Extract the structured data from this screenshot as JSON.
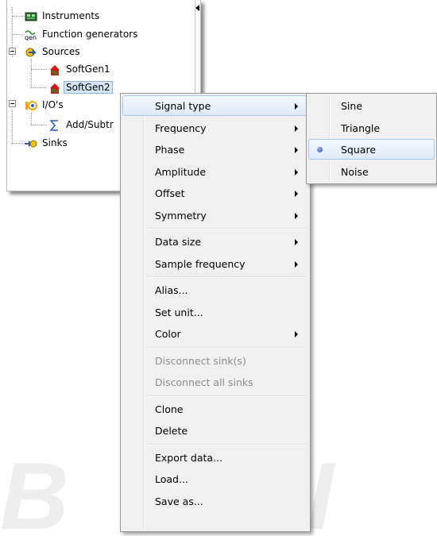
{
  "tree": {
    "items": [
      {
        "label": "Instruments",
        "icon": "instruments-icon"
      },
      {
        "label": "Function generators",
        "icon": "gen-icon"
      },
      {
        "label": "Sources",
        "icon": "sources-icon"
      },
      {
        "label": "SoftGen1",
        "icon": "softgen-icon"
      },
      {
        "label": "SoftGen2",
        "icon": "softgen-icon"
      },
      {
        "label": "I/O's",
        "icon": "io-icon"
      },
      {
        "label": "Add/Subtr",
        "icon": "sum-icon"
      },
      {
        "label": "Sinks",
        "icon": "sinks-icon"
      }
    ],
    "gen_glyph": "gen"
  },
  "context_menu": {
    "groups": [
      [
        {
          "label": "Signal type",
          "submenu": true,
          "highlighted": true
        },
        {
          "label": "Frequency",
          "submenu": true
        },
        {
          "label": "Phase",
          "submenu": true
        },
        {
          "label": "Amplitude",
          "submenu": true
        },
        {
          "label": "Offset",
          "submenu": true
        },
        {
          "label": "Symmetry",
          "submenu": true
        }
      ],
      [
        {
          "label": "Data size",
          "submenu": true
        },
        {
          "label": "Sample frequency",
          "submenu": true
        }
      ],
      [
        {
          "label": "Alias..."
        },
        {
          "label": "Set unit..."
        },
        {
          "label": "Color",
          "submenu": true
        }
      ],
      [
        {
          "label": "Disconnect sink(s)",
          "disabled": true
        },
        {
          "label": "Disconnect all sinks",
          "disabled": true
        }
      ],
      [
        {
          "label": "Clone"
        },
        {
          "label": "Delete"
        }
      ],
      [
        {
          "label": "Export data..."
        },
        {
          "label": "Load..."
        },
        {
          "label": "Save as..."
        }
      ]
    ]
  },
  "signal_type_submenu": {
    "items": [
      {
        "label": "Sine"
      },
      {
        "label": "Triangle"
      },
      {
        "label": "Square",
        "selected": true
      },
      {
        "label": "Noise"
      }
    ]
  },
  "watermark": "B W I"
}
